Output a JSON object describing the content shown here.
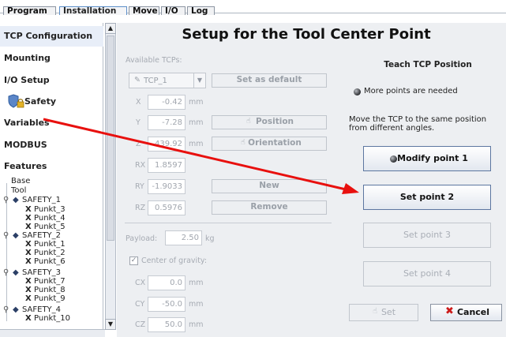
{
  "tabs": [
    {
      "label": "Program"
    },
    {
      "label": "Installation"
    },
    {
      "label": "Move"
    },
    {
      "label": "I/O"
    },
    {
      "label": "Log"
    }
  ],
  "sidebar": {
    "items": [
      {
        "label": "TCP Configuration"
      },
      {
        "label": "Mounting"
      },
      {
        "label": "I/O Setup"
      },
      {
        "label": "Safety"
      },
      {
        "label": "Variables"
      },
      {
        "label": "MODBUS"
      },
      {
        "label": "Features"
      }
    ],
    "tree": [
      "Base",
      "Tool",
      "SAFETY_1",
      "Punkt_3",
      "Punkt_4",
      "Punkt_5",
      "SAFETY_2",
      "Punkt_1",
      "Punkt_2",
      "Punkt_6",
      "SAFETY_3",
      "Punkt_7",
      "Punkt_8",
      "Punkt_9",
      "SAFETY_4",
      "Punkt_10"
    ]
  },
  "main": {
    "title": "Setup for the Tool Center Point",
    "available_label": "Available TCPs:",
    "tcp_selected": "TCP_1",
    "set_default": "Set as default",
    "x_label": "X",
    "x_value": "-0.42",
    "y_label": "Y",
    "y_value": "-7.28",
    "z_label": "Z",
    "z_value": "439.92",
    "rx_label": "RX",
    "rx_value": "1.8597",
    "ry_label": "RY",
    "ry_value": "-1.9033",
    "rz_label": "RZ",
    "rz_value": "0.5976",
    "unit_mm": "mm",
    "position_btn": "Position",
    "orientation_btn": "Orientation",
    "new_btn": "New",
    "remove_btn": "Remove",
    "payload_label": "Payload:",
    "payload_value": "2.50",
    "payload_unit": "kg",
    "cog_label": "Center of gravity:",
    "cx_label": "CX",
    "cx_value": "0.0",
    "cy_label": "CY",
    "cy_value": "-50.0",
    "cz_label": "CZ",
    "cz_value": "50.0"
  },
  "teach": {
    "heading": "Teach TCP Position",
    "status": "More points are needed",
    "instruction_1": "Move the TCP to the same position",
    "instruction_2": "from different angles.",
    "modify_point": "Modify point 1",
    "set_point_2": "Set point 2",
    "set_point_3": "Set point 3",
    "set_point_4": "Set point 4",
    "set_btn": "Set",
    "cancel_btn": "Cancel"
  },
  "colors": {
    "annotation_arrow": "#e8100e",
    "cancel_x": "#cc1a1a"
  }
}
